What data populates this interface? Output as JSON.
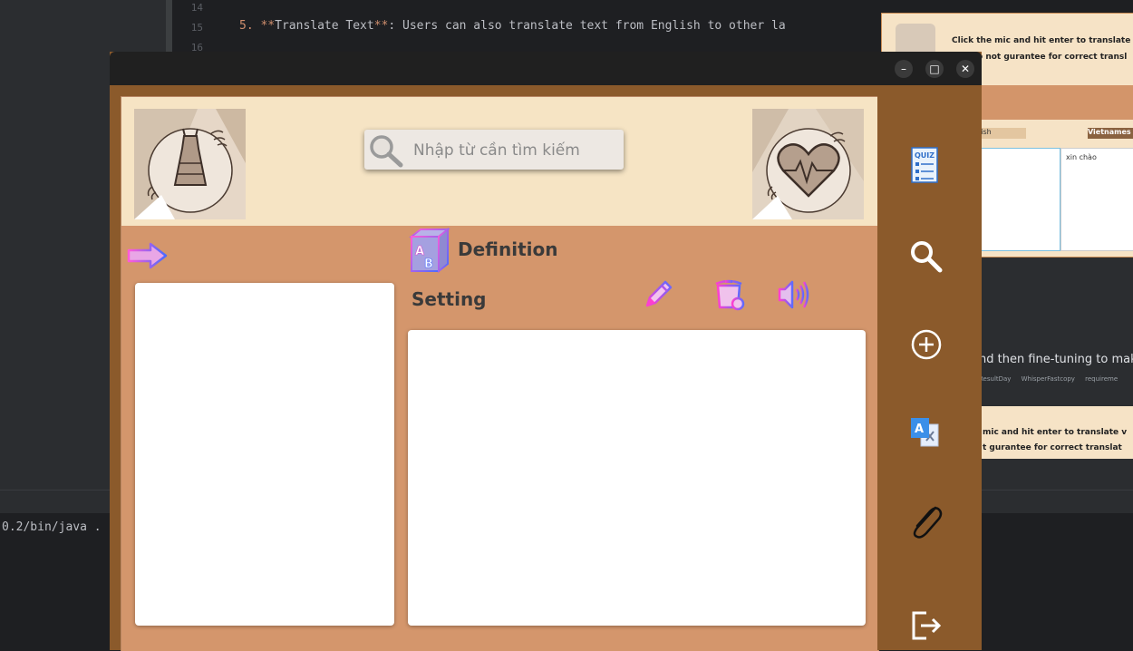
{
  "ide": {
    "line_numbers": [
      "14",
      "15",
      "16"
    ],
    "code_num": "5.",
    "code_bold_open": "**",
    "code_bold_text": "Translate Text",
    "code_bold_close": "**",
    "code_rest": ": Users can also translate text from English to other la",
    "terminal_text": "0.2/bin/java ."
  },
  "bg_app": {
    "hint_line1": "Click the mic and hit enter to translate",
    "hint_line2": "o not gurantee for correct transl",
    "select_from": "lish",
    "select_to": "Vietnames",
    "output_text": "xin chào",
    "doc_text": "nd then fine-tuning to make",
    "files": [
      "ResultDay",
      "WhisperFastcopy",
      "requireme"
    ],
    "hint2_line1": "mic and hit enter to translate v",
    "hint2_line2": "t gurantee for correct translat"
  },
  "window": {
    "minimize": "–",
    "maximize": "□",
    "close": "✕"
  },
  "search": {
    "placeholder": "Nhập từ cần tìm kiếm",
    "value": ""
  },
  "definition": {
    "label": "Definition"
  },
  "setting": {
    "label": "Setting"
  },
  "toolbar": {
    "icons": [
      "pencil-icon",
      "delete-icon",
      "speaker-icon"
    ]
  },
  "sidebar": {
    "quiz_label": "QUIZ",
    "translate_glyph": "A",
    "icons": [
      "quiz-icon",
      "search-icon",
      "add-icon",
      "translate-icon",
      "paperclip-icon",
      "logout-icon"
    ]
  },
  "colors": {
    "window_bg": "#8b5a2b",
    "content_bg": "#d4966c",
    "header_bg": "#f6e4c4",
    "accent_gradient_from": "#ff3fd0",
    "accent_gradient_to": "#3f6bff"
  }
}
